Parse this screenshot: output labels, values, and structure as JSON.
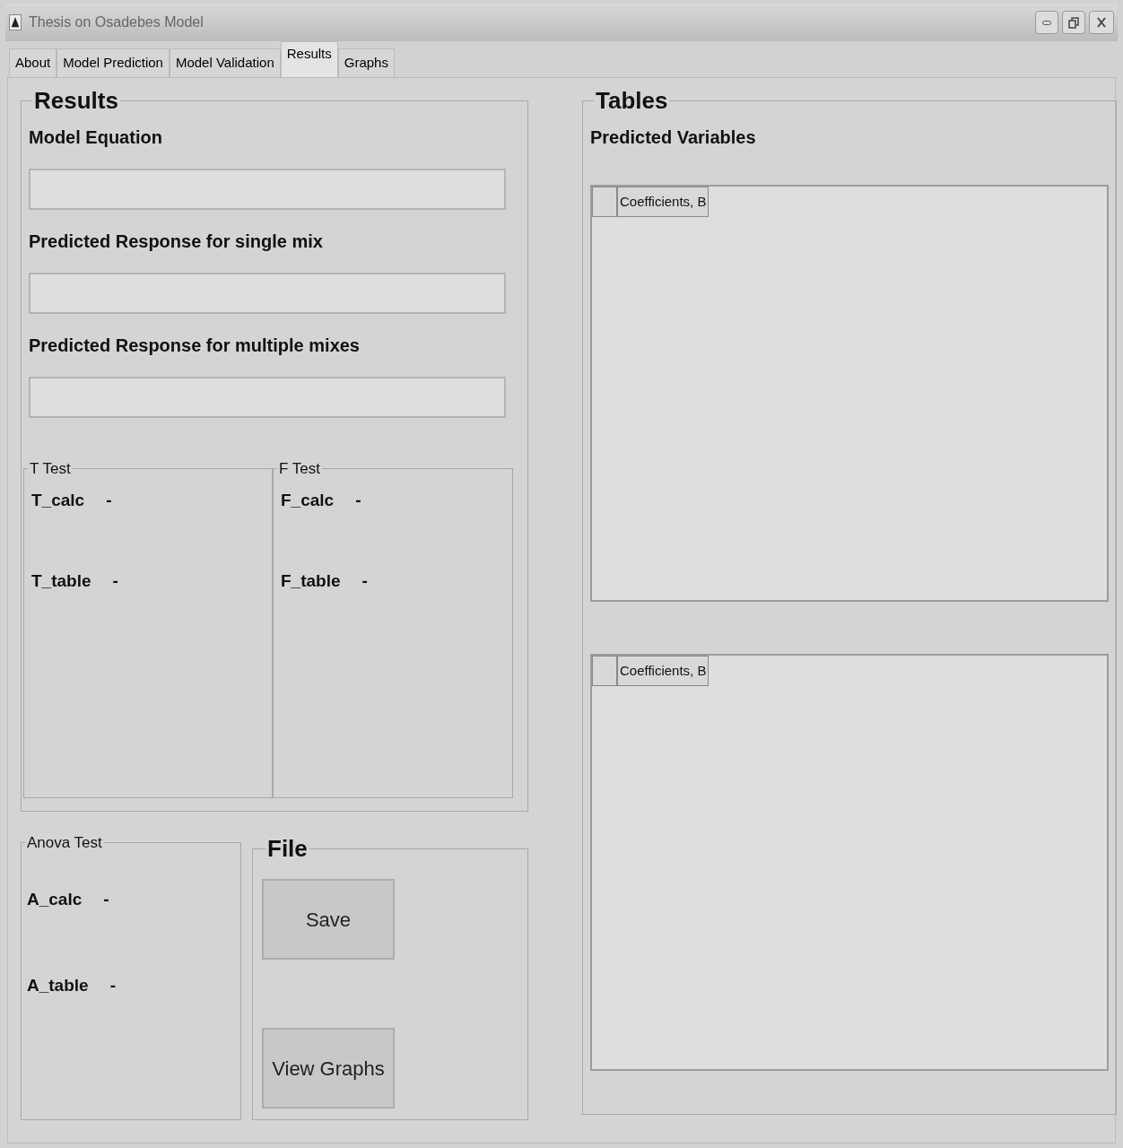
{
  "window": {
    "title": "Thesis on Osadebes Model"
  },
  "tabs": [
    {
      "label": "About",
      "selected": false
    },
    {
      "label": "Model Prediction",
      "selected": false
    },
    {
      "label": "Model Validation",
      "selected": false
    },
    {
      "label": "Results",
      "selected": true
    },
    {
      "label": "Graphs",
      "selected": false
    }
  ],
  "results": {
    "title": "Results",
    "fields": [
      {
        "label": "Model Equation"
      },
      {
        "label": "Predicted Response for single mix"
      },
      {
        "label": "Predicted Response for multiple mixes"
      }
    ],
    "tests": [
      {
        "title": "T Test",
        "rows": [
          {
            "label": "T_calc",
            "value": "-"
          },
          {
            "label": "T_table",
            "value": "-"
          }
        ]
      },
      {
        "title": "F Test",
        "rows": [
          {
            "label": "F_calc",
            "value": "-"
          },
          {
            "label": "F_table",
            "value": "-"
          }
        ]
      }
    ]
  },
  "anova": {
    "title": "Anova Test",
    "rows": [
      {
        "label": "A_calc",
        "value": "-"
      },
      {
        "label": "A_table",
        "value": "-"
      }
    ]
  },
  "file": {
    "title": "File",
    "buttons": [
      "Save",
      "View Graphs"
    ]
  },
  "tables": {
    "title": "Tables",
    "subtitle": "Predicted Variables",
    "grids": [
      {
        "columns": [
          "Coefficients, B"
        ]
      },
      {
        "columns": [
          "Coefficients, B"
        ]
      }
    ]
  }
}
